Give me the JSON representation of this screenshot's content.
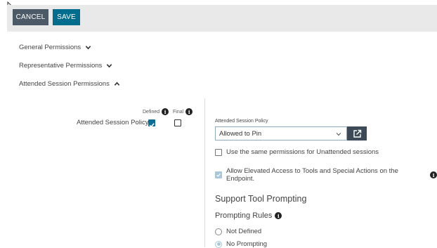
{
  "toolbar": {
    "cancel_label": "CANCEL",
    "save_label": "SAVE"
  },
  "sections": [
    {
      "label": "General Permissions",
      "expanded": false
    },
    {
      "label": "Representative Permissions",
      "expanded": false
    },
    {
      "label": "Attended Session Permissions",
      "expanded": true
    }
  ],
  "permissions_table": {
    "col_defined": "Defined",
    "col_final": "Final",
    "row_label": "Attended Session Policy",
    "defined_checked": true,
    "final_checked": false
  },
  "policy": {
    "field_label": "Attended Session Policy",
    "selected_value": "Allowed to Pin"
  },
  "options": {
    "same_permissions_label": "Use the same permissions for Unattended sessions",
    "same_permissions_checked": false,
    "elevated_label": "Allow Elevated Access to Tools and Special Actions on the Endpoint.",
    "elevated_checked": true
  },
  "support_tool": {
    "heading": "Support Tool Prompting",
    "rules_label": "Prompting Rules",
    "radios": [
      {
        "label": "Not Defined",
        "selected": false
      },
      {
        "label": "No Prompting",
        "selected": true
      }
    ]
  },
  "colors": {
    "primary": "#006d8f",
    "secondary": "#4b5a66",
    "checked": "#0a6e96"
  }
}
